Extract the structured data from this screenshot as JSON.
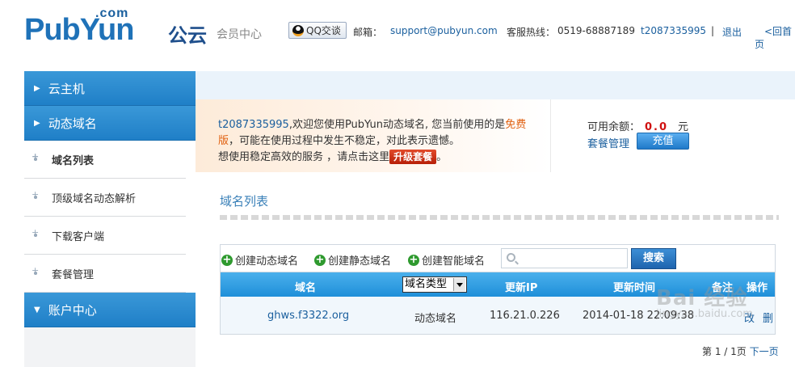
{
  "header": {
    "logo_com": ".com",
    "logo_brand": "PubYun",
    "logo_cn": "公云",
    "member_center": "会员中心",
    "qq_button": "QQ交谈",
    "email_label": "邮箱：",
    "email": "support@pubyun.com",
    "hotline_label": "客服热线：",
    "hotline": "0519-68887189",
    "username": "t2087335995",
    "separator": "|",
    "logout": "退出",
    "home": "<回首页"
  },
  "sidebar": {
    "cat_cloud": "云主机",
    "cat_ddns": "动态域名",
    "items": [
      {
        "label": "域名列表"
      },
      {
        "label": "顶级域名动态解析"
      },
      {
        "label": "下载客户端"
      },
      {
        "label": "套餐管理"
      }
    ],
    "cat_account": "账户中心"
  },
  "notice": {
    "uid": "t2087335995",
    "text1": ",欢迎您使用PubYun动态域名, 您当前使用的是",
    "free": "免费版",
    "text2": "，可能在使用过程中发生不稳定，对此表示遗憾。",
    "text3": "想使用稳定高效的服务 ，请点击这里",
    "upgrade": "升级套餐",
    "text4": "。"
  },
  "account": {
    "balance_label": "可用余额：",
    "balance": "0.0",
    "unit": "元",
    "package_manage": "套餐管理",
    "recharge": "充值"
  },
  "main": {
    "section_title": "域名列表",
    "create_dynamic": "创建动态域名",
    "create_static": "创建静态域名",
    "create_smart": "创建智能域名",
    "search_placeholder": "",
    "search_button": "搜索"
  },
  "table": {
    "headers": {
      "domain": "域名",
      "type_select": "域名类型",
      "ip": "更新IP",
      "time": "更新时间",
      "note": "备注",
      "ops": "操作"
    },
    "rows": [
      {
        "domain": "ghws.f3322.org",
        "type": "动态域名",
        "ip": "116.21.0.226",
        "time": "2014-01-18 22:09:38",
        "edit": "改",
        "delete": "删"
      }
    ]
  },
  "pager": {
    "info": "第 1 / 1页",
    "next": "下一页"
  },
  "watermark": {
    "main": "Bai 经验",
    "sub": "jingyan.baidu.com"
  }
}
